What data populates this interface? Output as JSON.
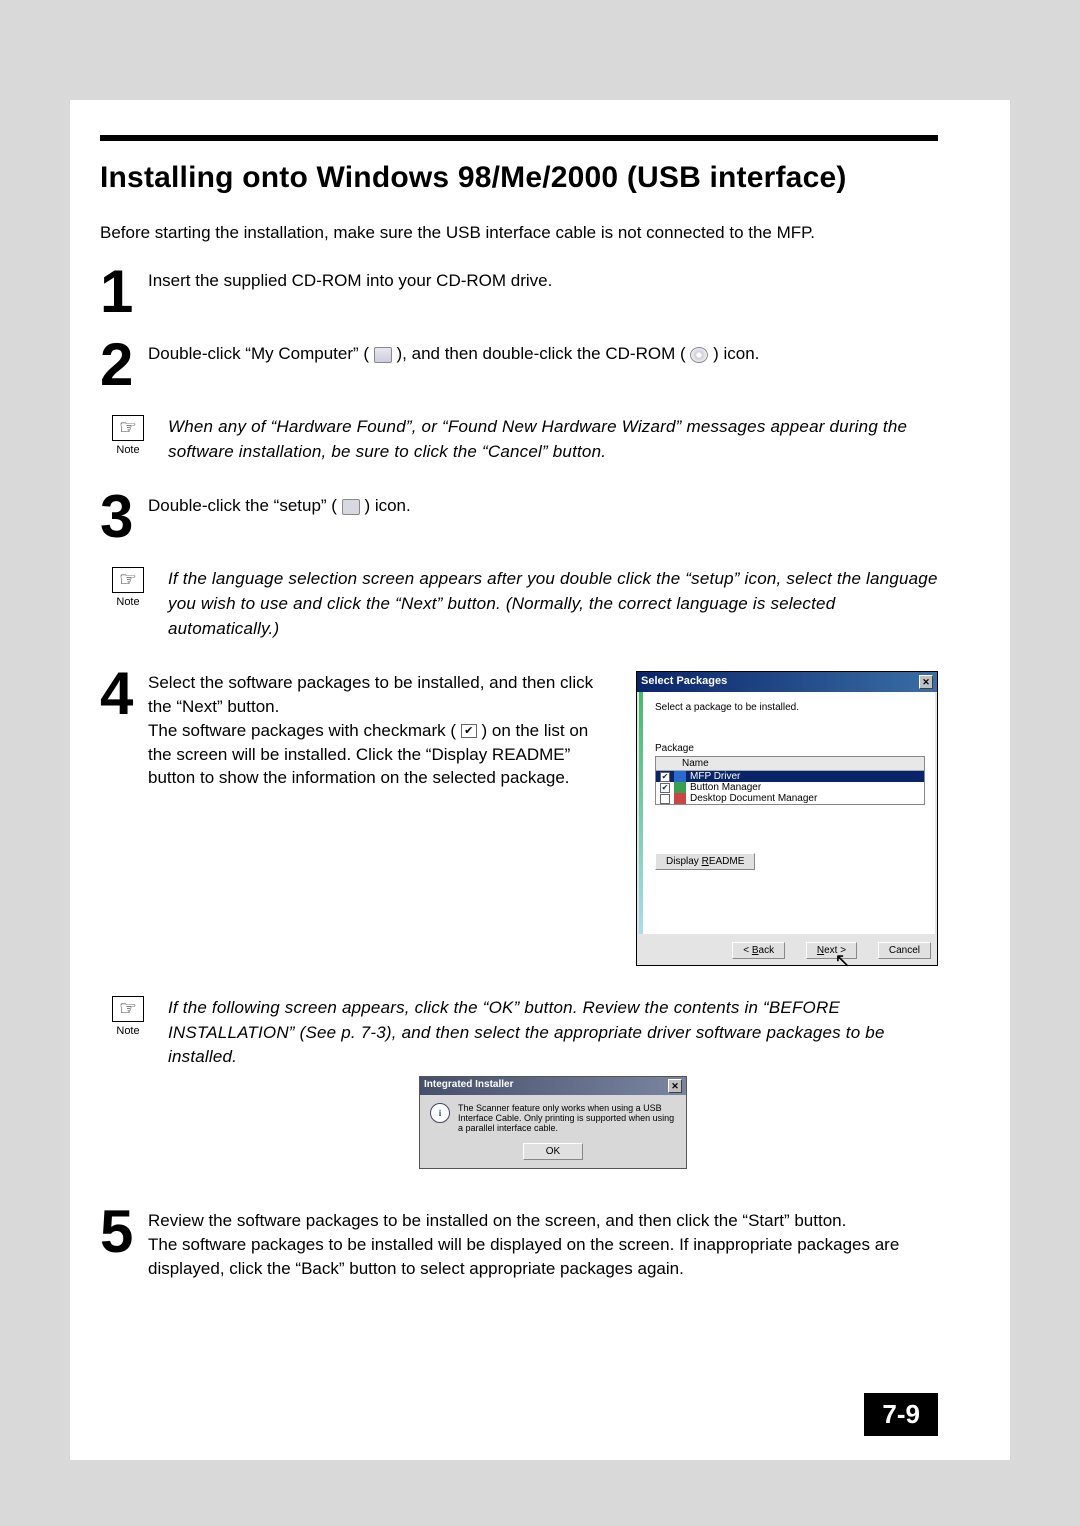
{
  "heading": "Installing onto Windows 98/Me/2000 (USB interface)",
  "intro": "Before starting the installation, make sure the USB interface cable is not connected to the MFP.",
  "steps": {
    "s1": {
      "num": "1",
      "text": "Insert the supplied CD-ROM into your CD-ROM drive."
    },
    "s2": {
      "num": "2",
      "pre": "Double-click “My Computer” (",
      "mid": "), and then double-click the CD-ROM (",
      "post": ") icon."
    },
    "s3": {
      "num": "3",
      "pre": "Double-click the “setup” (",
      "post": ") icon."
    },
    "s4": {
      "num": "4",
      "line1": "Select the software packages to be installed, and then click the “Next” button.",
      "line2a": "The software packages with checkmark (",
      "line2b": ") on the list on the screen will be installed. Click the “Display README” button to show the information on the selected package."
    },
    "s5": {
      "num": "5",
      "line1": "Review the software packages to be installed on the screen, and then click the “Start” button.",
      "line2": "The software packages to be installed will be displayed on the screen. If inappropriate packages are displayed, click the “Back” button to select appropriate packages again."
    }
  },
  "notes": {
    "label": "Note",
    "n1": "When any of “Hardware Found”, or “Found New Hardware Wizard” messages appear during the software installation, be sure to click the “Cancel” button.",
    "n2": "If the language selection screen appears after you double click the “setup” icon, select the language you wish to use and click the “Next” button. (Normally, the correct language is selected automatically.)",
    "n3": "If the following screen appears, click the “OK” button. Review the contents in “BEFORE INSTALLATION” (See p. 7-3), and then select the appropriate driver software packages to be installed."
  },
  "dialog1": {
    "title": "Select Packages",
    "instruction": "Select a package to be installed.",
    "package_label": "Package",
    "col_name": "Name",
    "rows": {
      "r1": "MFP Driver",
      "r2": "Button Manager",
      "r3": "Desktop Document Manager"
    },
    "readme_btn": "Display README",
    "back_u": "B",
    "back_rest": "ack",
    "back_prefix": "< ",
    "next_u": "N",
    "next_rest": "ext >",
    "cancel": "Cancel"
  },
  "dialog2": {
    "title": "Integrated Installer",
    "msg": "The Scanner feature only works when using a USB Interface Cable. Only printing is supported when using a parallel interface cable.",
    "ok": "OK"
  },
  "page_number": "7-9"
}
